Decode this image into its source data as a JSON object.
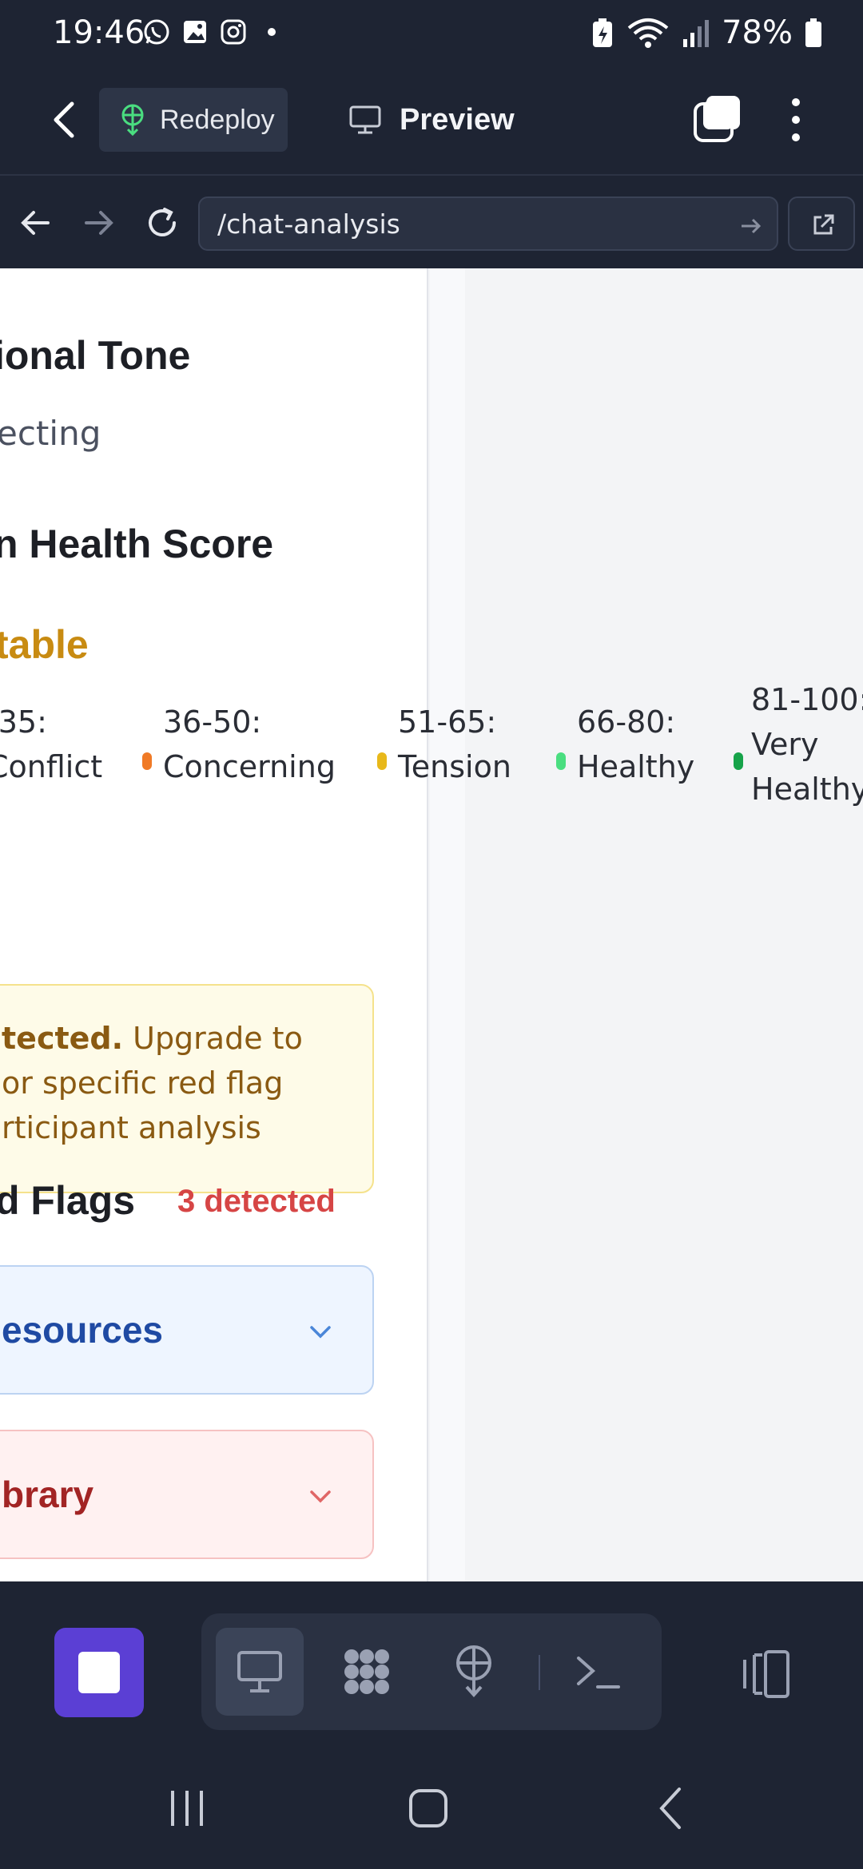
{
  "status_bar": {
    "time": "19:46",
    "battery_percent": "78%",
    "notification_icons": [
      "whatsapp-icon",
      "gallery-icon",
      "instagram-icon",
      "dot-icon"
    ],
    "system_icons": [
      "battery-saver-icon",
      "wifi-icon",
      "signal-icon",
      "battery-icon"
    ]
  },
  "toolbar": {
    "redeploy_label": "Redeploy",
    "preview_label": "Preview"
  },
  "browser": {
    "url": "/chat-analysis"
  },
  "page": {
    "tone_heading": "ional Tone",
    "tone_value": "ecting",
    "health_heading": "n Health Score",
    "health_value": "table",
    "legend": [
      {
        "range": "-35:",
        "label": "Conflict",
        "color": "#e04444"
      },
      {
        "range": "36-50:",
        "label": "Concerning",
        "color": "#f07a26"
      },
      {
        "range": "51-65:",
        "label": "Tension",
        "color": "#e8b81a"
      },
      {
        "range": "66-80:",
        "label": "Healthy",
        "color": "#4ade80"
      },
      {
        "range": "81-100:",
        "label_line1": "Very",
        "label_line2": "Healthy",
        "color": "#16a34a"
      }
    ],
    "flags_heading": "d Flags",
    "flags_count": "3 detected",
    "notice": {
      "bold": "tected.",
      "line1_rest": " Upgrade to",
      "line2": "or specific red flag",
      "line3": "rticipant analysis"
    },
    "accordion_resources": "esources",
    "accordion_library": "brary"
  },
  "colors": {
    "accent": "#5b3fd4",
    "health_value": "#c88b12",
    "flags_count": "#d64545"
  }
}
